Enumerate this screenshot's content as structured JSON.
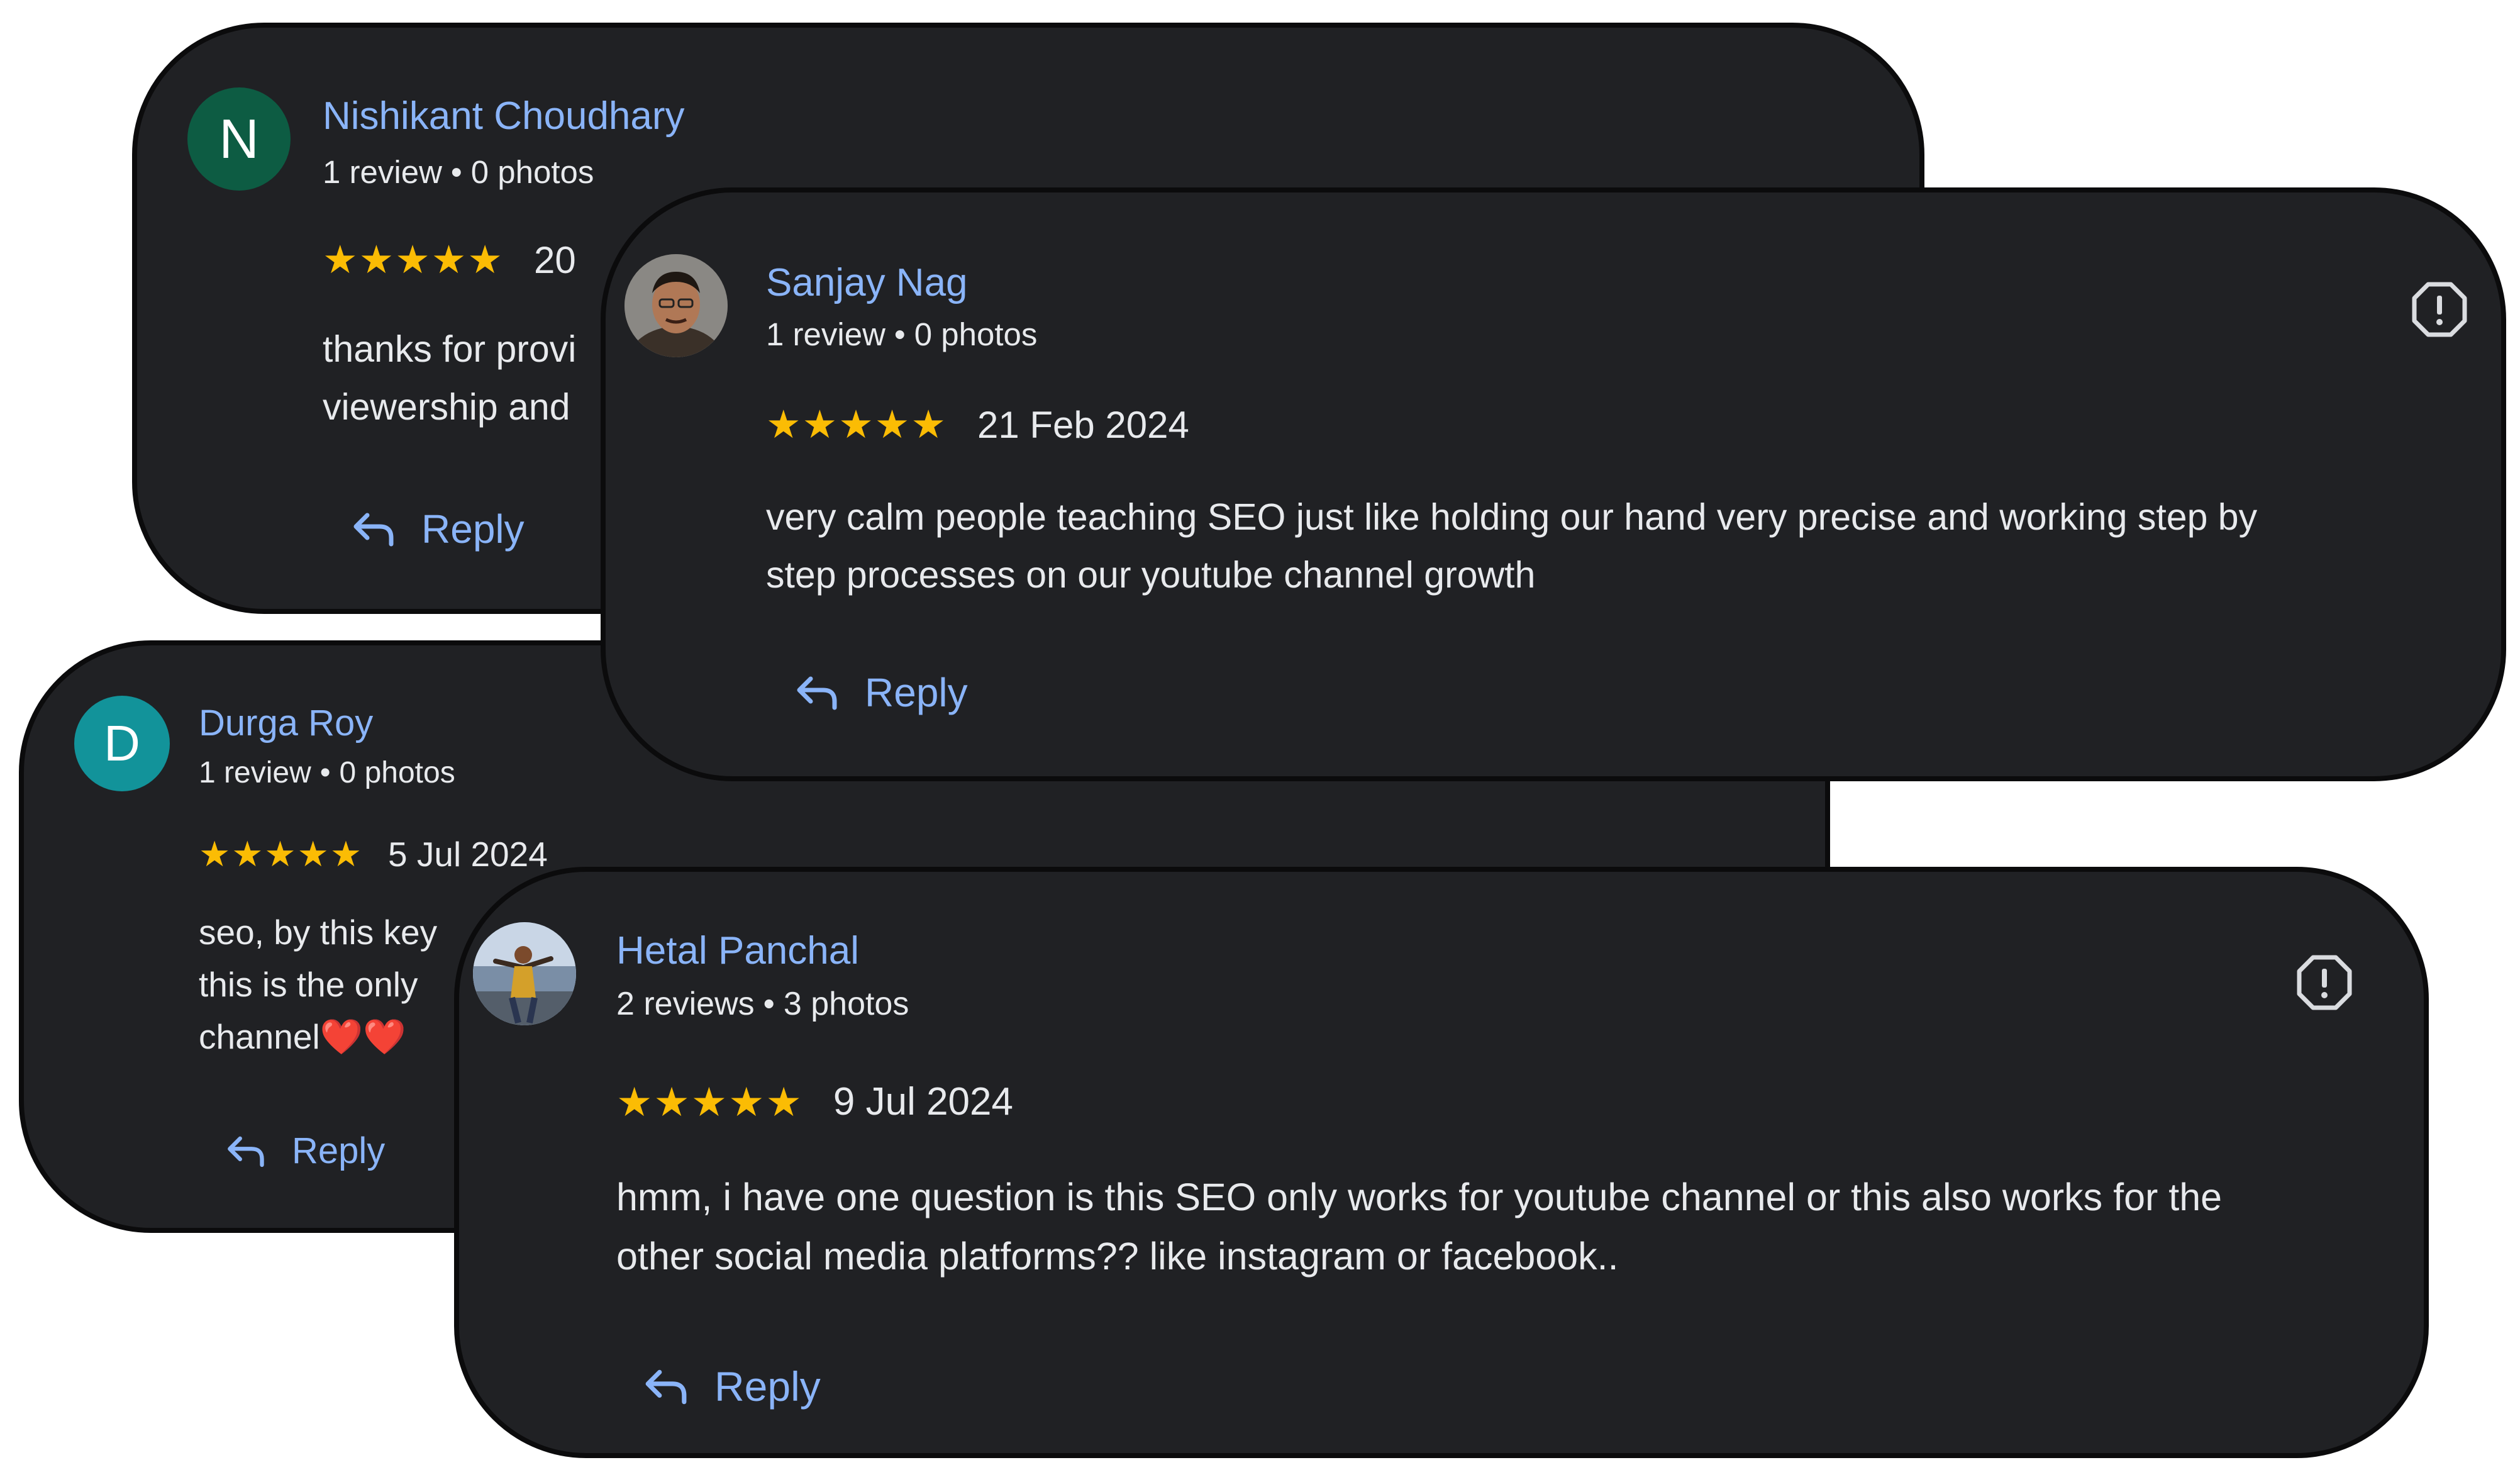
{
  "reviews": [
    {
      "author": "Nishikant Choudhary",
      "avatar_letter": "N",
      "avatar_color": "#0d5c43",
      "meta_reviews": "1 review",
      "meta_photos": "0 photos",
      "rating": 5,
      "date": "20",
      "text_line1": "thanks for provi",
      "text_line2": "viewership and",
      "reply_label": "Reply"
    },
    {
      "author": "Sanjay Nag",
      "avatar_type": "photo",
      "meta_reviews": "1 review",
      "meta_photos": "0 photos",
      "rating": 5,
      "date": "21 Feb 2024",
      "text_line1": "very calm people teaching SEO just like holding our hand very precise and working step by",
      "text_line2": "step processes on our youtube channel growth",
      "reply_label": "Reply",
      "report_icon": "report-flag-icon"
    },
    {
      "author": "Durga Roy",
      "avatar_letter": "D",
      "avatar_color": "#12939a",
      "meta_reviews": "1 review",
      "meta_photos": "0 photos",
      "rating": 5,
      "date": "5 Jul 2024",
      "text_line1": "seo, by this key",
      "text_line2": "this is the only",
      "text_line3": "channel❤️❤️",
      "reply_label": "Reply"
    },
    {
      "author": "Hetal Panchal",
      "avatar_type": "photo",
      "meta_reviews": "2 reviews",
      "meta_photos": "3 photos",
      "rating": 5,
      "date": "9 Jul 2024",
      "text_line1": "hmm, i have one question is this SEO only works for youtube channel or this also works for the",
      "text_line2": "other social media platforms?? like instagram or facebook..",
      "reply_label": "Reply",
      "report_icon": "report-flag-icon"
    }
  ],
  "colors": {
    "card_bg": "#202124",
    "link": "#8ab4f8",
    "star": "#fbbc04"
  }
}
